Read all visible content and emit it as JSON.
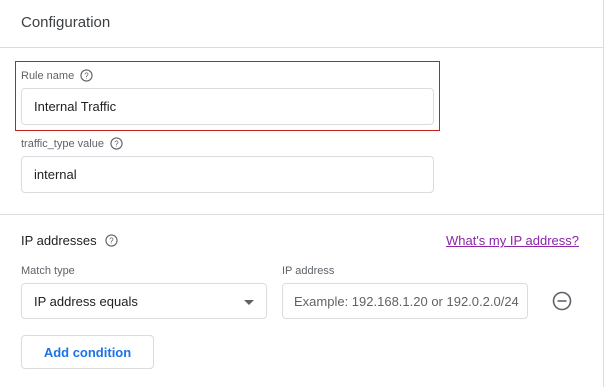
{
  "header": {
    "title": "Configuration"
  },
  "rule_name": {
    "label": "Rule name",
    "value": "Internal Traffic"
  },
  "traffic_type": {
    "label": "traffic_type value",
    "value": "internal"
  },
  "ip_section": {
    "title": "IP addresses",
    "link": "What's my IP address?",
    "match_type_label": "Match type",
    "match_type_value": "IP address equals",
    "ip_label": "IP address",
    "ip_placeholder": "Example: 192.168.1.20 or 192.0.2.0/24",
    "add_button": "Add condition"
  },
  "colors": {
    "accent": "#1a73e8",
    "link_visited": "#8e24aa",
    "highlight": "#c5221f"
  }
}
